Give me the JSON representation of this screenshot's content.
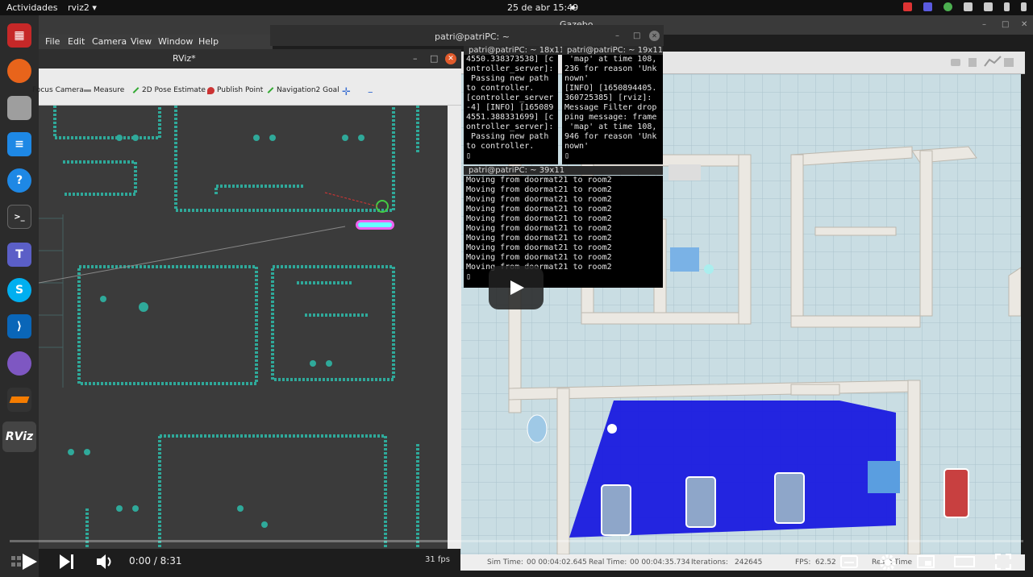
{
  "topbar": {
    "activities": "Actividades",
    "app_name": "rviz2 ▾",
    "clock": "25 de abr  15:49"
  },
  "dock": {
    "icons": [
      "ros-icon",
      "firefox-icon",
      "files-icon",
      "writer-icon",
      "help-icon",
      "terminal-icon",
      "teams-icon",
      "skype-icon",
      "vscode-icon",
      "network-icon",
      "layers-icon",
      "rviz-icon"
    ]
  },
  "gazebo": {
    "title": "Gazebo",
    "status": {
      "sim_time_label": "Sim Time:",
      "sim_time": "00 00:04:02.645",
      "real_time_label": "Real Time:",
      "real_time": "00 00:04:35.734",
      "iterations_label": "Iterations:",
      "iterations": "242645",
      "fps_label": "FPS:",
      "fps": "62.52",
      "reset_label": "Reset Time"
    }
  },
  "rviz": {
    "menu": [
      "File",
      "Edit",
      "Camera",
      "View",
      "Window",
      "Help"
    ],
    "title": "RViz*",
    "tools": [
      "Focus Camera",
      "Measure",
      "2D Pose Estimate",
      "Publish Point",
      "Navigation2 Goal"
    ],
    "fps": "31 fps"
  },
  "terminals": {
    "main_title": "patri@patriPC: ~",
    "left": {
      "title": "patri@patriPC: ~ 18x11",
      "lines": [
        "4550.338373538] [c",
        "ontroller_server]:",
        " Passing new path",
        "to controller.",
        "[controller_server",
        "-4] [INFO] [165089",
        "4551.388331699] [c",
        "ontroller_server]:",
        " Passing new path",
        "to controller.",
        "▯"
      ]
    },
    "right": {
      "title": "patri@patriPC: ~ 19x11",
      "lines": [
        " 'map' at time 108,",
        "236 for reason 'Unk",
        "nown'",
        "[INFO] [1650894405.",
        "360725385] [rviz]:",
        "Message Filter drop",
        "ping message: frame",
        " 'map' at time 108,",
        "946 for reason 'Unk",
        "nown'",
        "▯"
      ]
    },
    "bottom": {
      "title": "patri@patriPC: ~ 39x11",
      "lines": [
        "Moving from doormat21 to room2",
        "Moving from doormat21 to room2",
        "Moving from doormat21 to room2",
        "Moving from doormat21 to room2",
        "Moving from doormat21 to room2",
        "Moving from doormat21 to room2",
        "Moving from doormat21 to room2",
        "Moving from doormat21 to room2",
        "Moving from doormat21 to room2",
        "Moving from doormat21 to room2",
        "▯"
      ]
    }
  },
  "video": {
    "time": "0:00 / 8:31",
    "progress": 0
  }
}
